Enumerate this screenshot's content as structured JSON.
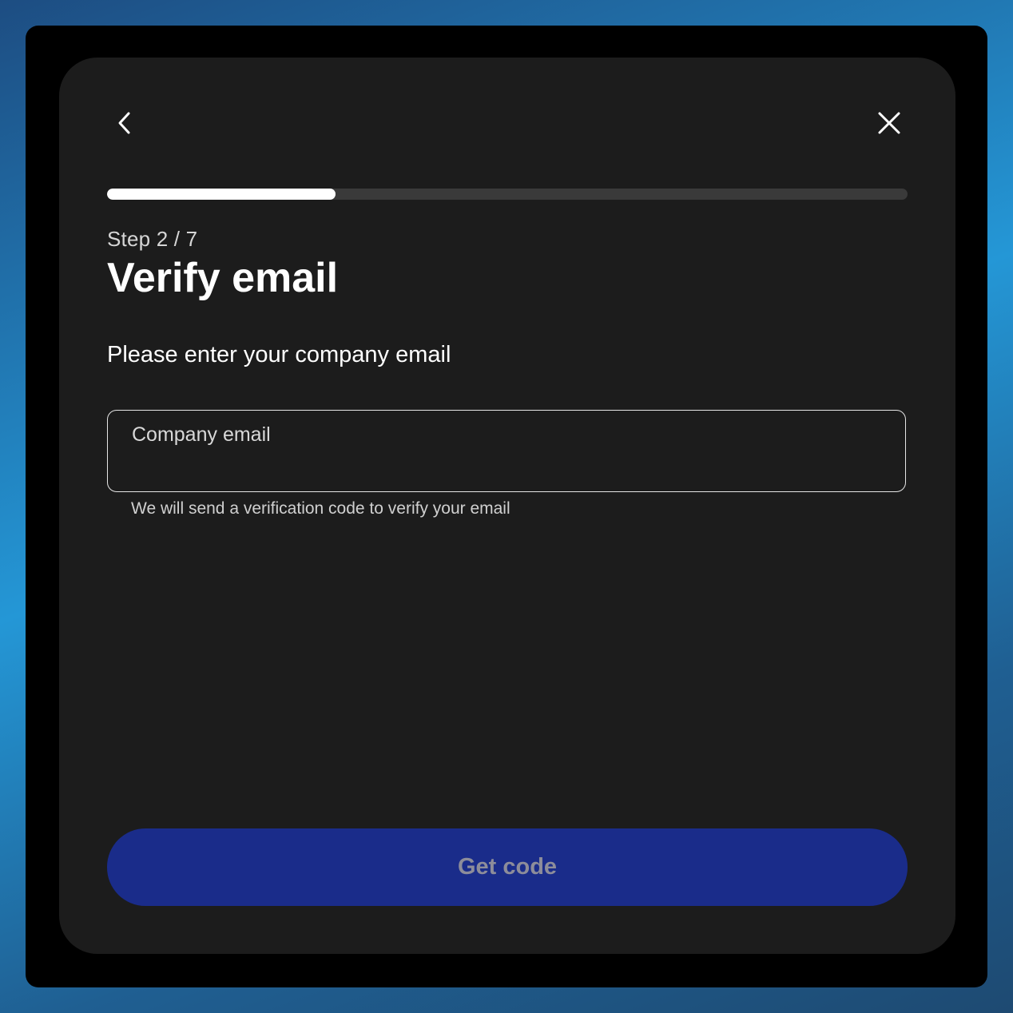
{
  "nav": {
    "back_icon": "chevron-left-icon",
    "close_icon": "close-icon"
  },
  "progress": {
    "current_step": 2,
    "total_steps": 7,
    "fraction": 0.285,
    "step_label": "Step 2 / 7"
  },
  "header": {
    "title": "Verify email"
  },
  "form": {
    "instruction": "Please enter your company email",
    "email_field": {
      "label": "Company email",
      "value": "",
      "helper": "We will send a verification code to verify your email"
    },
    "submit_label": "Get code"
  },
  "colors": {
    "card_background": "#1c1c1c",
    "frame_background": "#000000",
    "progress_track": "#3a3a3a",
    "progress_fill": "#ffffff",
    "button_background": "#1a2c8a",
    "button_text": "#8d8d9a"
  }
}
